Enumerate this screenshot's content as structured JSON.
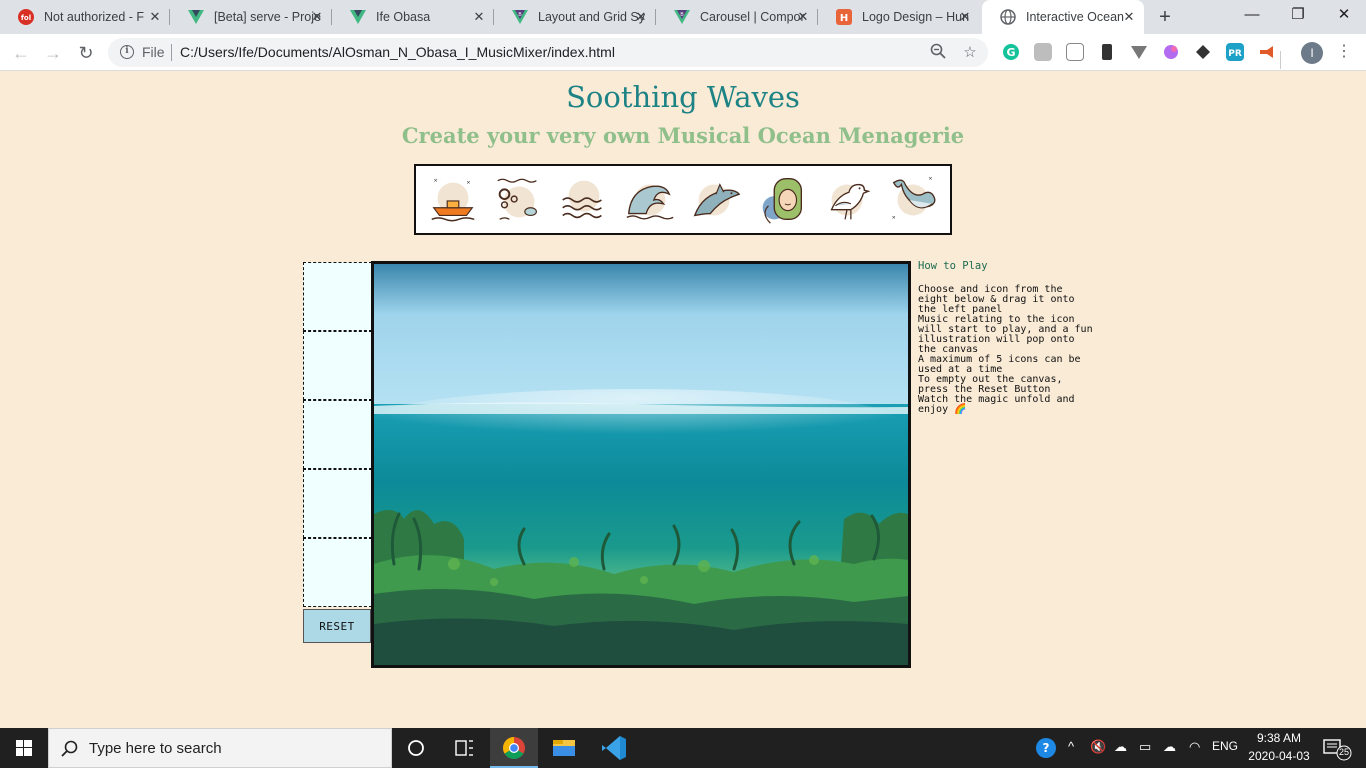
{
  "browser": {
    "tabs": [
      {
        "title": "Not authorized - F",
        "icon": "fol-icon"
      },
      {
        "title": "[Beta] serve - Proje",
        "icon": "vue-icon"
      },
      {
        "title": "Ife Obasa",
        "icon": "vue-icon"
      },
      {
        "title": "Layout and Grid Sy",
        "icon": "bootstrap-vue-icon"
      },
      {
        "title": "Carousel | Compor",
        "icon": "bootstrap-vue-icon"
      },
      {
        "title": "Logo Design – Hun",
        "icon": "hunter-icon"
      },
      {
        "title": "Interactive Ocean",
        "icon": "globe-icon"
      }
    ],
    "active_tab": 6,
    "new_tab": "+",
    "address": {
      "scheme_label": "File",
      "url": "C:/Users/Ife/Documents/AlOsman_N_Obasa_I_MusicMixer/index.html"
    },
    "profile_initial": "I"
  },
  "page": {
    "title": "Soothing Waves",
    "subtitle": "Create your very own Musical Ocean Menagerie",
    "icons": [
      "boat-icon",
      "bubbles-fish-icon",
      "waves-icon",
      "big-wave-icon",
      "dolphin-icon",
      "mermaid-icon",
      "seagull-icon",
      "whale-icon"
    ],
    "drop_zones": 5,
    "reset_label": "RESET",
    "howto": {
      "title": "How to Play",
      "lines": [
        "Choose and icon from the eight below & drag it onto the left panel",
        "Music relating to the icon will start to play, and a fun illustration will pop onto the canvas",
        "A maximum of 5 icons can be used at a time",
        "To empty out the canvas, press the Reset Button",
        "Watch the magic unfold and enjoy 🌈"
      ]
    }
  },
  "taskbar": {
    "search_placeholder": "Type here to search",
    "language": "ENG",
    "time": "9:38 AM",
    "date": "2020-04-03",
    "notification_count": "25"
  }
}
